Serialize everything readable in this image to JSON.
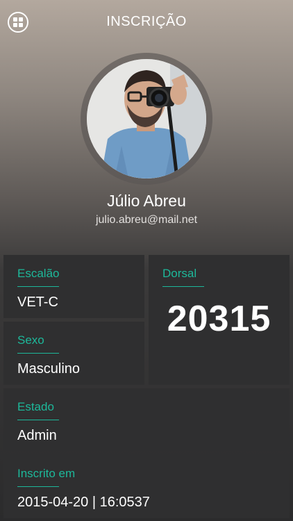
{
  "header": {
    "title": "INSCRIÇÃO",
    "menu_icon": "grid-icon"
  },
  "profile": {
    "name": "Júlio Abreu",
    "email": "julio.abreu@mail.net",
    "avatar_icon": "user-photo"
  },
  "fields": {
    "escalao": {
      "label": "Escalão",
      "value": "VET-C"
    },
    "sexo": {
      "label": "Sexo",
      "value": "Masculino"
    },
    "dorsal": {
      "label": "Dorsal",
      "value": "20315"
    },
    "estado": {
      "label": "Estado",
      "value": "Admin"
    },
    "inscrito": {
      "label": "Inscrito em",
      "value": "2015-04-20 | 16:0537"
    }
  },
  "colors": {
    "accent": "#1db89a",
    "card": "#2f2f30",
    "text": "#ffffff"
  }
}
